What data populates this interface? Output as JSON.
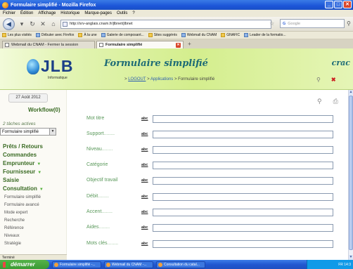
{
  "window": {
    "title": "Formulaire simplifié - Mozilla Firefox",
    "controls": [
      "_",
      "□",
      "✕"
    ]
  },
  "menubar": [
    "Fichier",
    "Édition",
    "Affichage",
    "Historique",
    "Marque-pages",
    "Outils",
    "?"
  ],
  "navbar": {
    "url": "http://srv-anglais.cnam.fr/jlbnet/jlbnet",
    "search_placeholder": "Google",
    "search_engine": "G"
  },
  "bookmarks": [
    "Les plus visités",
    "Débuter avec Firefox",
    "À la une",
    "Galerie de composant...",
    "Sites suggérés",
    "Webmail du CNAM",
    "GNAFIC",
    "Leader de la formatio..."
  ],
  "tabs": [
    {
      "label": "Webmail du CNAM - Fermer la session"
    },
    {
      "label": "Formulaire simplifié",
      "close": "✕"
    }
  ],
  "tab_new": "+",
  "banner": {
    "logo_text": "JLB",
    "logo_sub": "Informatique",
    "heading": "Formulaire simplifié",
    "right_text": "crac",
    "breadcrumb": {
      "sep": ">",
      "logout": "LOGOUT",
      "applications": "Applications",
      "current": "Formulaire simplifié"
    },
    "key_icon": "⚲",
    "close_icon": "✖"
  },
  "sidebar": {
    "date": "27 Août 2012",
    "workflow": "Workflow(0)",
    "tasks_label": "2 tâches actives",
    "select_value": "Formulaire simplifié",
    "select_arrow": "▼",
    "main_menu": [
      {
        "label": "Prêts / Retours",
        "arrow": ""
      },
      {
        "label": "Commandes",
        "arrow": ""
      },
      {
        "label": "Emprunteur",
        "arrow": "▼"
      },
      {
        "label": "Fournisseur",
        "arrow": "▼"
      },
      {
        "label": "Saisie",
        "arrow": ""
      },
      {
        "label": "Consultation",
        "arrow": "▼"
      }
    ],
    "sub_menu": [
      "Formulaire simplifié",
      "Formulaire avancé",
      "Mode expert",
      "Recherche",
      "Référence",
      "Niveaux",
      "Stratégie"
    ]
  },
  "form": {
    "icons": {
      "search": "⚲",
      "print": "⎙"
    },
    "fields": [
      {
        "label": "Mot titre",
        "dots": "",
        "type": "abc",
        "value": ""
      },
      {
        "label": "Support",
        "dots": "........",
        "type": "abc",
        "value": ""
      },
      {
        "label": "Niveau",
        "dots": "........",
        "type": "abc",
        "value": ""
      },
      {
        "label": "Catégorie",
        "dots": "",
        "type": "abc",
        "value": ""
      },
      {
        "label": "Objectif travail",
        "dots": "",
        "type": "abc",
        "value": ""
      },
      {
        "label": "Débit",
        "dots": "........",
        "type": "abc",
        "value": ""
      },
      {
        "label": "Accent",
        "dots": "........",
        "type": "abc",
        "value": ""
      },
      {
        "label": "Aides",
        "dots": "........",
        "type": "abc",
        "value": ""
      },
      {
        "label": "Mots clés",
        "dots": "........",
        "type": "abc",
        "value": ""
      }
    ]
  },
  "statusbar": "Terminé",
  "taskbar": {
    "start": "démarrer",
    "tasks": [
      "Formulaire simplifié -...",
      "Webmail du CNAM -...",
      "Consultation du catal..."
    ],
    "tray": "FR  14:3"
  }
}
